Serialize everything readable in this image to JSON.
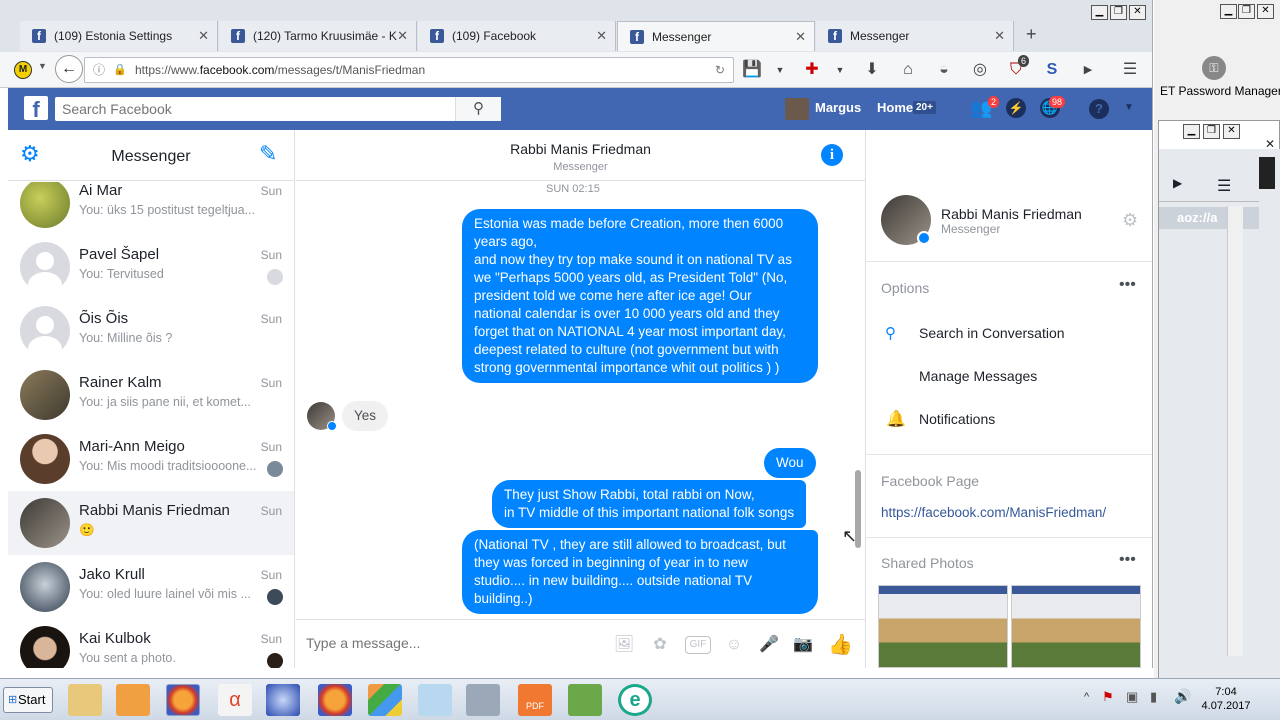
{
  "browser": {
    "tabs": [
      {
        "title": "(109) Estonia Settings"
      },
      {
        "title": "(120) Tarmo Kruusimäe - K"
      },
      {
        "title": "(109) Facebook"
      },
      {
        "title": "Messenger"
      },
      {
        "title": "Messenger"
      }
    ],
    "url_prefix": "https://www.",
    "url_domain": "facebook.com",
    "url_path": "/messages/t/ManisFriedman",
    "extension_badge": "6"
  },
  "fb_header": {
    "search_placeholder": "Search Facebook",
    "user_name": "Margus",
    "home_label": "Home",
    "home_count": "20+",
    "friend_requests_badge": "2",
    "notifications_badge": "98"
  },
  "messenger": {
    "left_title": "Messenger",
    "conversations": [
      {
        "name": "Ai Mar",
        "preview": "You: üks 15 postitust tegeltjua...",
        "date": "Sun"
      },
      {
        "name": "Pavel Šapel",
        "preview": "You: Tervitused",
        "date": "Sun"
      },
      {
        "name": "Õis Õis",
        "preview": "You: Milline õis ?",
        "date": "Sun"
      },
      {
        "name": "Rainer Kalm",
        "preview": "You: ja siis pane nii, et komet...",
        "date": "Sun"
      },
      {
        "name": "Mari-Ann Meigo",
        "preview": "You: Mis moodi traditsioooone...",
        "date": "Sun"
      },
      {
        "name": "Rabbi Manis Friedman",
        "preview": "🙂",
        "date": "Sun"
      },
      {
        "name": "Jako Krull",
        "preview": "You: oled luure lainel või mis ...",
        "date": "Sun"
      },
      {
        "name": "Kai Kulbok",
        "preview": "You sent a photo.",
        "date": "Sun"
      }
    ],
    "chat": {
      "name": "Rabbi Manis Friedman",
      "subtitle": "Messenger",
      "timestamp": "SUN 02:15",
      "messages": [
        {
          "from": "me",
          "lines": [
            "Estonia was made before Creation, more then 6000",
            "years ago,",
            "and now they try top make sound it on national TV as",
            "we \"Perhaps 5000 years old, as President Told\" (No,",
            "president told we come here after ice age! Our",
            "national calendar is over 10 000 years old and they",
            "forget that on NATIONAL 4 year most important day,",
            "deepest related to culture (not government but with",
            "strong governmental importance whit out politics  ) )"
          ]
        },
        {
          "from": "them",
          "lines": [
            "Yes"
          ]
        },
        {
          "from": "me",
          "lines": [
            "Wou"
          ]
        },
        {
          "from": "me",
          "lines": [
            "They just Show Rabbi, total rabbi on Now,",
            "in TV middle of this important national folk songs"
          ]
        },
        {
          "from": "me",
          "lines": [
            "(National TV , they are still allowed to broadcast, but",
            "they was forced in beginning of year in to new",
            "studio.... in new building.... outside national TV",
            "building..)"
          ]
        }
      ],
      "composer_placeholder": "Type a message..."
    },
    "info_panel": {
      "name": "Rabbi Manis Friedman",
      "subtitle": "Messenger",
      "options_label": "Options",
      "options": [
        "Search in Conversation",
        "Manage Messages",
        "Notifications"
      ],
      "page_label": "Facebook Page",
      "page_link": "https://facebook.com/ManisFriedman/",
      "shared_photos_label": "Shared Photos"
    }
  },
  "side_window": {
    "title": "ET Password Manager",
    "text": "aoz://a"
  },
  "taskbar": {
    "start_label": "Start",
    "time": "7:04",
    "date": "4.07.2017"
  },
  "colors": {
    "fb_blue": "#4267b2",
    "messenger_blue": "#0084ff"
  }
}
